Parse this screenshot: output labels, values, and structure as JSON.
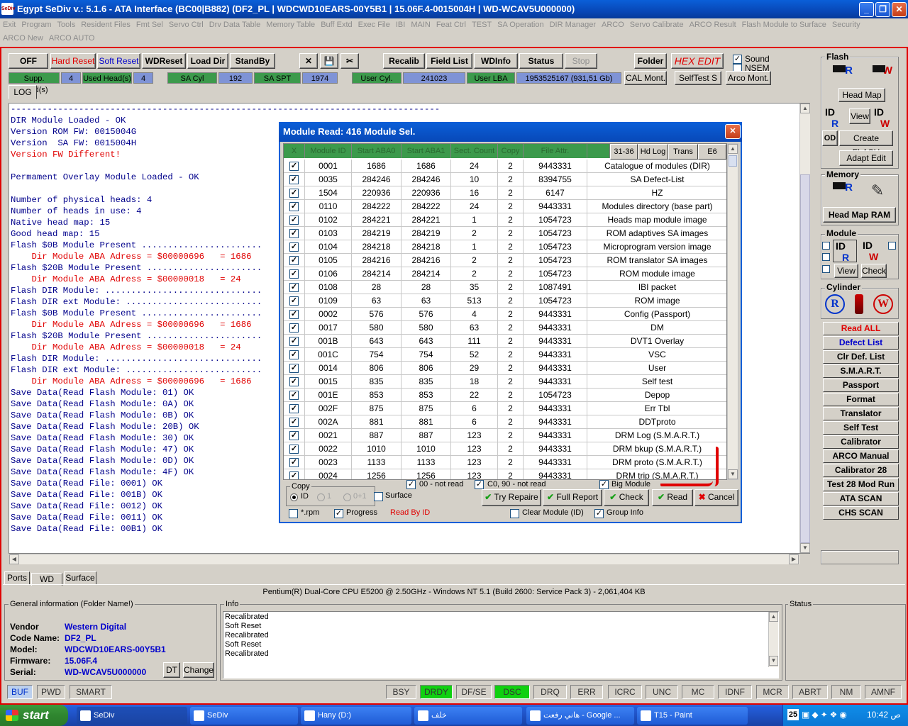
{
  "window": {
    "title": "Egypt  SeDiv v.: 5.1.6 - ATA Interface (BC00|B882)  (DF2_PL  |  WDCWD10EARS-00Y5B1  |  15.06F.4-0015004H  |  WD-WCAV5U000000)",
    "logo": "SeDiv"
  },
  "menu": [
    "Exit",
    "Program",
    "Tools",
    "Resident Files",
    "Fmt Sel",
    "Servo Ctrl",
    "Drv Data Table",
    "Memory Table",
    "Buff Extd",
    "Exec File",
    "IBI",
    "MAIN",
    "Feat Ctrl",
    "TEST",
    "SA Operation",
    "DIR Manager",
    "ARCO",
    "Servo Calibrate",
    "ARCO Result",
    "Flash Module to Surface",
    "Security",
    "ARCO New",
    "ARCO AUTO"
  ],
  "toolbar": {
    "off": "OFF",
    "hard_reset": "Hard Reset",
    "soft_reset": "Soft Reset",
    "wdreset": "WDReset",
    "load_dir": "Load Dir",
    "standby": "StandBy",
    "recalib": "Recalib",
    "field_list": "Field List",
    "wdinfo": "WDInfo",
    "status": "Status",
    "stop": "Stop",
    "folder": "Folder",
    "hex_edit": "HEX EDIT",
    "sound": "Sound",
    "nsem": "NSEM",
    "cal_mont": "CAL Mont.",
    "selftest_s": "SelfTest S",
    "arco_mont": "Arco Mont."
  },
  "info_bar": {
    "supp_heads_label": "Supp. Head(s)",
    "supp_heads": "4",
    "used_heads_label": "Used Head(s)",
    "used_heads": "4",
    "sa_cyl_label": "SA Cyl",
    "sa_cyl": "192",
    "sa_spt_label": "SA SPT",
    "sa_spt": "1974",
    "user_cyl_label": "User Cyl.",
    "user_cyl": "241023",
    "user_lba_label": "User LBA",
    "user_lba": "1953525167  (931,51 Gb)"
  },
  "log_tab": "LOG",
  "log_lines": [
    {
      "t": "----------------------------------------------------------------------------------",
      "c": ""
    },
    {
      "t": "DIR Module Loaded - OK",
      "c": ""
    },
    {
      "t": "Version ROM FW: 0015004G",
      "c": ""
    },
    {
      "t": "Version  SA FW: 0015004H",
      "c": ""
    },
    {
      "t": "Version FW Different!",
      "c": "red"
    },
    {
      "t": "",
      "c": ""
    },
    {
      "t": "Permament Overlay Module Loaded - OK",
      "c": ""
    },
    {
      "t": "",
      "c": ""
    },
    {
      "t": "Number of physical heads: 4",
      "c": ""
    },
    {
      "t": "Number of heads in use: 4",
      "c": ""
    },
    {
      "t": "Native head map: 15",
      "c": ""
    },
    {
      "t": "Good head map: 15",
      "c": ""
    },
    {
      "t": "Flash $0B Module Present .......................",
      "c": ""
    },
    {
      "t": "    Dir Module ABA Adress = $00000696   = 1686",
      "c": "red"
    },
    {
      "t": "Flash $20B Module Present ......................",
      "c": ""
    },
    {
      "t": "    Dir Module ABA Adress = $00000018   = 24",
      "c": "red"
    },
    {
      "t": "Flash DIR Module: ..............................",
      "c": ""
    },
    {
      "t": "Flash DIR ext Module: ..........................",
      "c": ""
    },
    {
      "t": "Flash $0B Module Present .......................",
      "c": ""
    },
    {
      "t": "    Dir Module ABA Adress = $00000696   = 1686",
      "c": "red"
    },
    {
      "t": "Flash $20B Module Present ......................",
      "c": ""
    },
    {
      "t": "    Dir Module ABA Adress = $00000018   = 24",
      "c": "red"
    },
    {
      "t": "Flash DIR Module: ..............................",
      "c": ""
    },
    {
      "t": "Flash DIR ext Module: ..........................",
      "c": ""
    },
    {
      "t": "    Dir Module ABA Adress = $00000696   = 1686",
      "c": "red"
    },
    {
      "t": "Save Data(Read Flash Module: 01) OK",
      "c": ""
    },
    {
      "t": "Save Data(Read Flash Module: 0A) OK",
      "c": ""
    },
    {
      "t": "Save Data(Read Flash Module: 0B) OK",
      "c": ""
    },
    {
      "t": "Save Data(Read Flash Module: 20B) OK",
      "c": ""
    },
    {
      "t": "Save Data(Read Flash Module: 30) OK",
      "c": ""
    },
    {
      "t": "Save Data(Read Flash Module: 47) OK",
      "c": ""
    },
    {
      "t": "Save Data(Read Flash Module: 0D) OK",
      "c": ""
    },
    {
      "t": "Save Data(Read Flash Module: 4F) OK",
      "c": ""
    },
    {
      "t": "Save Data(Read File: 0001) OK",
      "c": ""
    },
    {
      "t": "Save Data(Read File: 001B) OK",
      "c": ""
    },
    {
      "t": "Save Data(Read File: 0012) OK",
      "c": ""
    },
    {
      "t": "Save Data(Read File: 0011) OK",
      "c": ""
    },
    {
      "t": "Save Data(Read File: 00B1) OK",
      "c": ""
    }
  ],
  "right_panel": {
    "flash": "Flash",
    "head_map": "Head Map",
    "view": "View",
    "od": "OD",
    "create_flash": "Create FLASH",
    "adapt_edit": "Adapt Edit",
    "memory": "Memory",
    "head_map_ram": "Head Map RAM",
    "module": "Module",
    "check": "Check",
    "cylinder": "Cylinder",
    "id": "ID",
    "r": "R",
    "w": "W",
    "buttons": [
      {
        "label": "Read ALL",
        "color": "#e00000"
      },
      {
        "label": "Defect List",
        "color": "#0000cc"
      },
      {
        "label": "Clr Def. List",
        "color": "#000"
      },
      {
        "label": "S.M.A.R.T.",
        "color": "#000"
      },
      {
        "label": "Passport",
        "color": "#000"
      },
      {
        "label": "Format",
        "color": "#000"
      },
      {
        "label": "Translator",
        "color": "#000"
      },
      {
        "label": "Self Test",
        "color": "#000"
      },
      {
        "label": "Calibrator (SA,UA)",
        "color": "#000"
      },
      {
        "label": "ARCO Manual",
        "color": "#000"
      },
      {
        "label": "Calibrator 28",
        "color": "#000"
      },
      {
        "label": "Test 28 Mod Run",
        "color": "#000"
      },
      {
        "label": "ATA SCAN",
        "color": "#000"
      },
      {
        "label": "CHS SCAN",
        "color": "#000"
      }
    ]
  },
  "dialog": {
    "title": "Module Read: 416 Module Sel.",
    "columns": [
      "X",
      "Module ID",
      "Start ABA0",
      "Start ABA1",
      "Sect. Count",
      "Copy",
      "File Attr."
    ],
    "header_buttons": [
      "31-36",
      "Hd Log",
      "Trans",
      "E6"
    ],
    "rows": [
      [
        "0001",
        "1686",
        "1686",
        "24",
        "2",
        "9443331",
        "Catalogue of modules (DIR)"
      ],
      [
        "0035",
        "284246",
        "284246",
        "10",
        "2",
        "8394755",
        "SA Defect-List"
      ],
      [
        "1504",
        "220936",
        "220936",
        "16",
        "2",
        "6147",
        "HZ"
      ],
      [
        "0110",
        "284222",
        "284222",
        "24",
        "2",
        "9443331",
        "Modules directory (base part)"
      ],
      [
        "0102",
        "284221",
        "284221",
        "1",
        "2",
        "1054723",
        "Heads map module image"
      ],
      [
        "0103",
        "284219",
        "284219",
        "2",
        "2",
        "1054723",
        "ROM adaptives SA images"
      ],
      [
        "0104",
        "284218",
        "284218",
        "1",
        "2",
        "1054723",
        "Microprogram version image"
      ],
      [
        "0105",
        "284216",
        "284216",
        "2",
        "2",
        "1054723",
        "ROM translator SA images"
      ],
      [
        "0106",
        "284214",
        "284214",
        "2",
        "2",
        "1054723",
        "ROM module image"
      ],
      [
        "0108",
        "28",
        "28",
        "35",
        "2",
        "1087491",
        "IBI packet"
      ],
      [
        "0109",
        "63",
        "63",
        "513",
        "2",
        "1054723",
        "ROM image"
      ],
      [
        "0002",
        "576",
        "576",
        "4",
        "2",
        "9443331",
        "Config (Passport)"
      ],
      [
        "0017",
        "580",
        "580",
        "63",
        "2",
        "9443331",
        "DM"
      ],
      [
        "001B",
        "643",
        "643",
        "111",
        "2",
        "9443331",
        "DVT1 Overlay"
      ],
      [
        "001C",
        "754",
        "754",
        "52",
        "2",
        "9443331",
        "VSC"
      ],
      [
        "0014",
        "806",
        "806",
        "29",
        "2",
        "9443331",
        "User"
      ],
      [
        "0015",
        "835",
        "835",
        "18",
        "2",
        "9443331",
        "Self test"
      ],
      [
        "001E",
        "853",
        "853",
        "22",
        "2",
        "1054723",
        "Depop"
      ],
      [
        "002F",
        "875",
        "875",
        "6",
        "2",
        "9443331",
        "Err Tbl"
      ],
      [
        "002A",
        "881",
        "881",
        "6",
        "2",
        "9443331",
        "DDTproto"
      ],
      [
        "0021",
        "887",
        "887",
        "123",
        "2",
        "9443331",
        "DRM Log (S.M.A.R.T.)"
      ],
      [
        "0022",
        "1010",
        "1010",
        "123",
        "2",
        "9443331",
        "DRM bkup (S.M.A.R.T.)"
      ],
      [
        "0023",
        "1133",
        "1133",
        "123",
        "2",
        "9443331",
        "DRM proto (S.M.A.R.T.)"
      ],
      [
        "0024",
        "1256",
        "1256",
        "123",
        "2",
        "9443331",
        "DRM trip (S.M.A.R.T.)"
      ]
    ],
    "copy_label": "Copy",
    "opt_id": "ID",
    "opt_1": "1",
    "opt_01": "0+1",
    "surface": "Surface",
    "not_read_00": "00 - not read",
    "not_read_c0": "C0, 90 - not read",
    "big_module": "Big Module",
    "rpm": "*.rpm",
    "progress": "Progress",
    "read_by_id": "Read By ID",
    "clear_module": "Clear Module (ID)",
    "group_info": "Group Info",
    "try_repaire": "Try Repaire",
    "full_report": "Full Report",
    "check": "Check",
    "read": "Read",
    "cancel": "Cancel"
  },
  "bottom_tabs": [
    "Ports",
    "WD",
    "Surface"
  ],
  "cpu_info": "Pentium(R) Dual-Core  CPU      E5200  @ 2.50GHz - Windows NT 5.1 (Build 2600: Service Pack 3) -  2,061,404 KB",
  "general": {
    "title": "General information (Folder Name!)",
    "vendor_label": "Vendor",
    "vendor": "Western Digital",
    "code_label": "Code Name:",
    "code": "DF2_PL",
    "model_label": "Model:",
    "model": "WDCWD10EARS-00Y5B1",
    "fw_label": "Firmware:",
    "fw": "15.06F.4",
    "serial_label": "Serial:",
    "serial": "WD-WCAV5U000000",
    "dt": "DT",
    "change": "Change"
  },
  "info": {
    "title": "Info",
    "lines": [
      "Recalibrated",
      "Soft Reset",
      "Recalibrated",
      "Soft Reset",
      "Recalibrated"
    ]
  },
  "status_title": "Status",
  "status_left": [
    "BUF",
    "PWD",
    "SMART"
  ],
  "status_flags": [
    {
      "l": "BSY",
      "on": false
    },
    {
      "l": "DRDY",
      "on": true
    },
    {
      "l": "DF/SE",
      "on": false
    },
    {
      "l": "DSC",
      "on": true
    },
    {
      "l": "DRQ",
      "on": false
    },
    {
      "l": "ERR",
      "on": false
    },
    {
      "l": "ICRC",
      "on": false
    },
    {
      "l": "UNC",
      "on": false
    },
    {
      "l": "MC",
      "on": false
    },
    {
      "l": "IDNF",
      "on": false
    },
    {
      "l": "MCR",
      "on": false
    },
    {
      "l": "ABRT",
      "on": false
    },
    {
      "l": "NM",
      "on": false
    },
    {
      "l": "AMNF",
      "on": false
    }
  ],
  "taskbar": {
    "start": "start",
    "items": [
      "SeDiv",
      "SeDiv",
      "Hany (D:)",
      "خلف",
      "هاني رفعت - Google ...",
      "T15 - Paint"
    ],
    "clock": "ص 10:42",
    "tray_num": "25"
  }
}
